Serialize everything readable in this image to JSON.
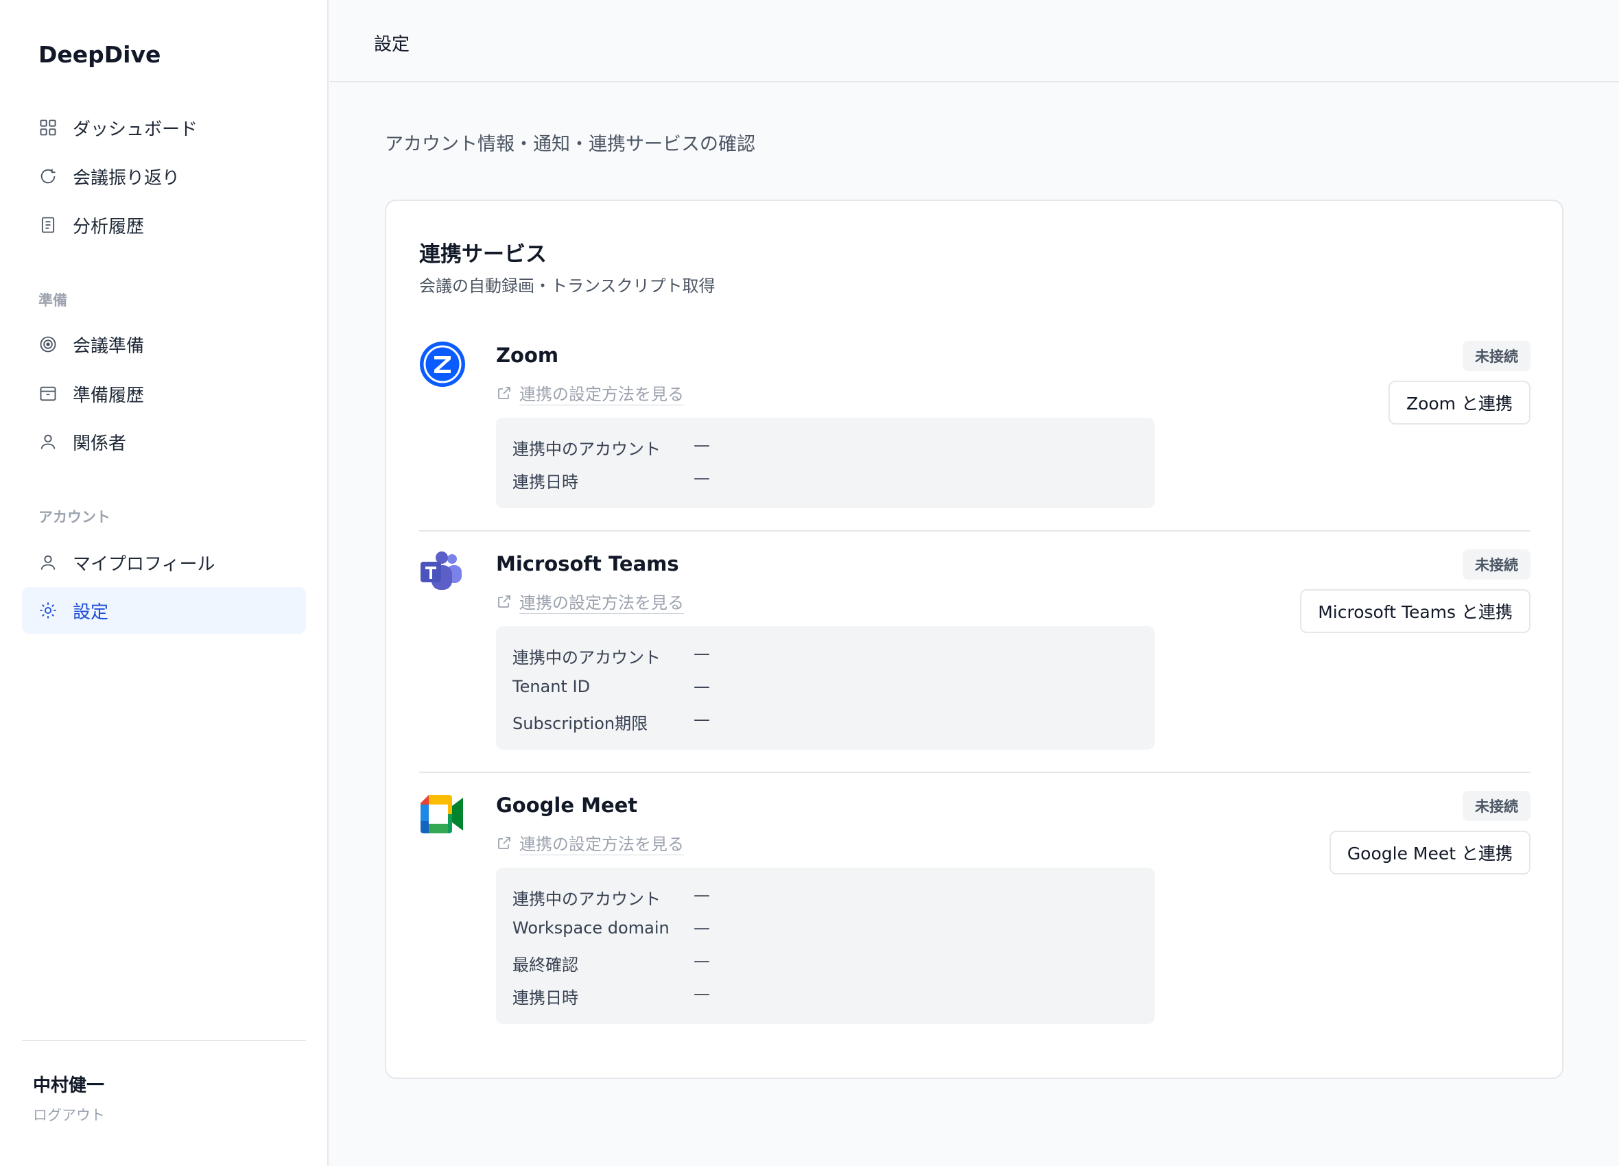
{
  "app": {
    "brand": "DeepDive"
  },
  "sidebar": {
    "main_items": [
      {
        "label": "ダッシュボード",
        "icon": "grid-icon"
      },
      {
        "label": "会議振り返り",
        "icon": "refresh-icon"
      },
      {
        "label": "分析履歴",
        "icon": "document-icon"
      }
    ],
    "section_prep": "準備",
    "prep_items": [
      {
        "label": "会議準備",
        "icon": "target-icon"
      },
      {
        "label": "準備履歴",
        "icon": "archive-icon"
      },
      {
        "label": "関係者",
        "icon": "user-icon"
      }
    ],
    "section_account": "アカウント",
    "account_items": [
      {
        "label": "マイプロフィール",
        "icon": "user-icon"
      },
      {
        "label": "設定",
        "icon": "gear-icon",
        "active": true
      }
    ],
    "user_name": "中村健一",
    "logout": "ログアウト"
  },
  "topbar": {
    "title": "設定"
  },
  "page": {
    "subtitle": "アカウント情報・通知・連携サービスの確認"
  },
  "integrations": {
    "title": "連携サービス",
    "description": "会議の自動録画・トランスクリプト取得",
    "services": [
      {
        "name": "Zoom",
        "link": "連携の設定方法を見る",
        "status": "未接続",
        "button": "Zoom と連携",
        "fields": [
          {
            "label": "連携中のアカウント",
            "value": "—"
          },
          {
            "label": "連携日時",
            "value": "—"
          }
        ]
      },
      {
        "name": "Microsoft Teams",
        "link": "連携の設定方法を見る",
        "status": "未接続",
        "button": "Microsoft Teams と連携",
        "fields": [
          {
            "label": "連携中のアカウント",
            "value": "—"
          },
          {
            "label": "Tenant ID",
            "value": "—"
          },
          {
            "label": "Subscription期限",
            "value": "—"
          }
        ]
      },
      {
        "name": "Google Meet",
        "link": "連携の設定方法を見る",
        "status": "未接続",
        "button": "Google Meet と連携",
        "fields": [
          {
            "label": "連携中のアカウント",
            "value": "—"
          },
          {
            "label": "Workspace domain",
            "value": "—"
          },
          {
            "label": "最終確認",
            "value": "—"
          },
          {
            "label": "連携日時",
            "value": "—"
          }
        ]
      }
    ]
  },
  "colors": {
    "accent": "#1d4ed8",
    "active_bg": "#eff6ff",
    "zoom_blue": "#0b5cff",
    "teams_purple": "#5b5fc7"
  }
}
